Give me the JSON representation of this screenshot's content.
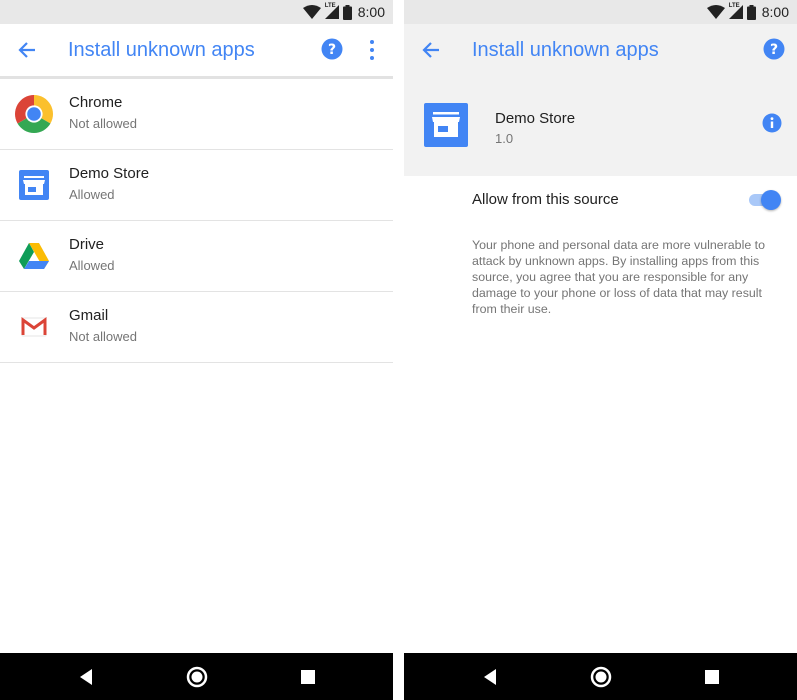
{
  "status_bar": {
    "network": "LTE",
    "time": "8:00"
  },
  "left_screen": {
    "app_bar": {
      "title": "Install unknown apps"
    },
    "apps": [
      {
        "name": "Chrome",
        "status": "Not allowed",
        "icon": "chrome-icon"
      },
      {
        "name": "Demo Store",
        "status": "Allowed",
        "icon": "store-icon"
      },
      {
        "name": "Drive",
        "status": "Allowed",
        "icon": "drive-icon"
      },
      {
        "name": "Gmail",
        "status": "Not allowed",
        "icon": "gmail-icon"
      }
    ]
  },
  "right_screen": {
    "app_bar": {
      "title": "Install unknown apps"
    },
    "app": {
      "name": "Demo Store",
      "version": "1.0",
      "icon": "store-icon"
    },
    "toggle": {
      "label": "Allow from this source",
      "enabled": true
    },
    "warning": "Your phone and personal data are more vulnerable to attack by unknown apps. By installing apps from this source, you agree that you are responsible for any damage to your phone or loss of data that may result from their use."
  },
  "colors": {
    "accent": "#4285f4",
    "toggle_track": "#a9c8f8",
    "status_bar": "#e8e8e8",
    "nav_bar": "#000000"
  }
}
